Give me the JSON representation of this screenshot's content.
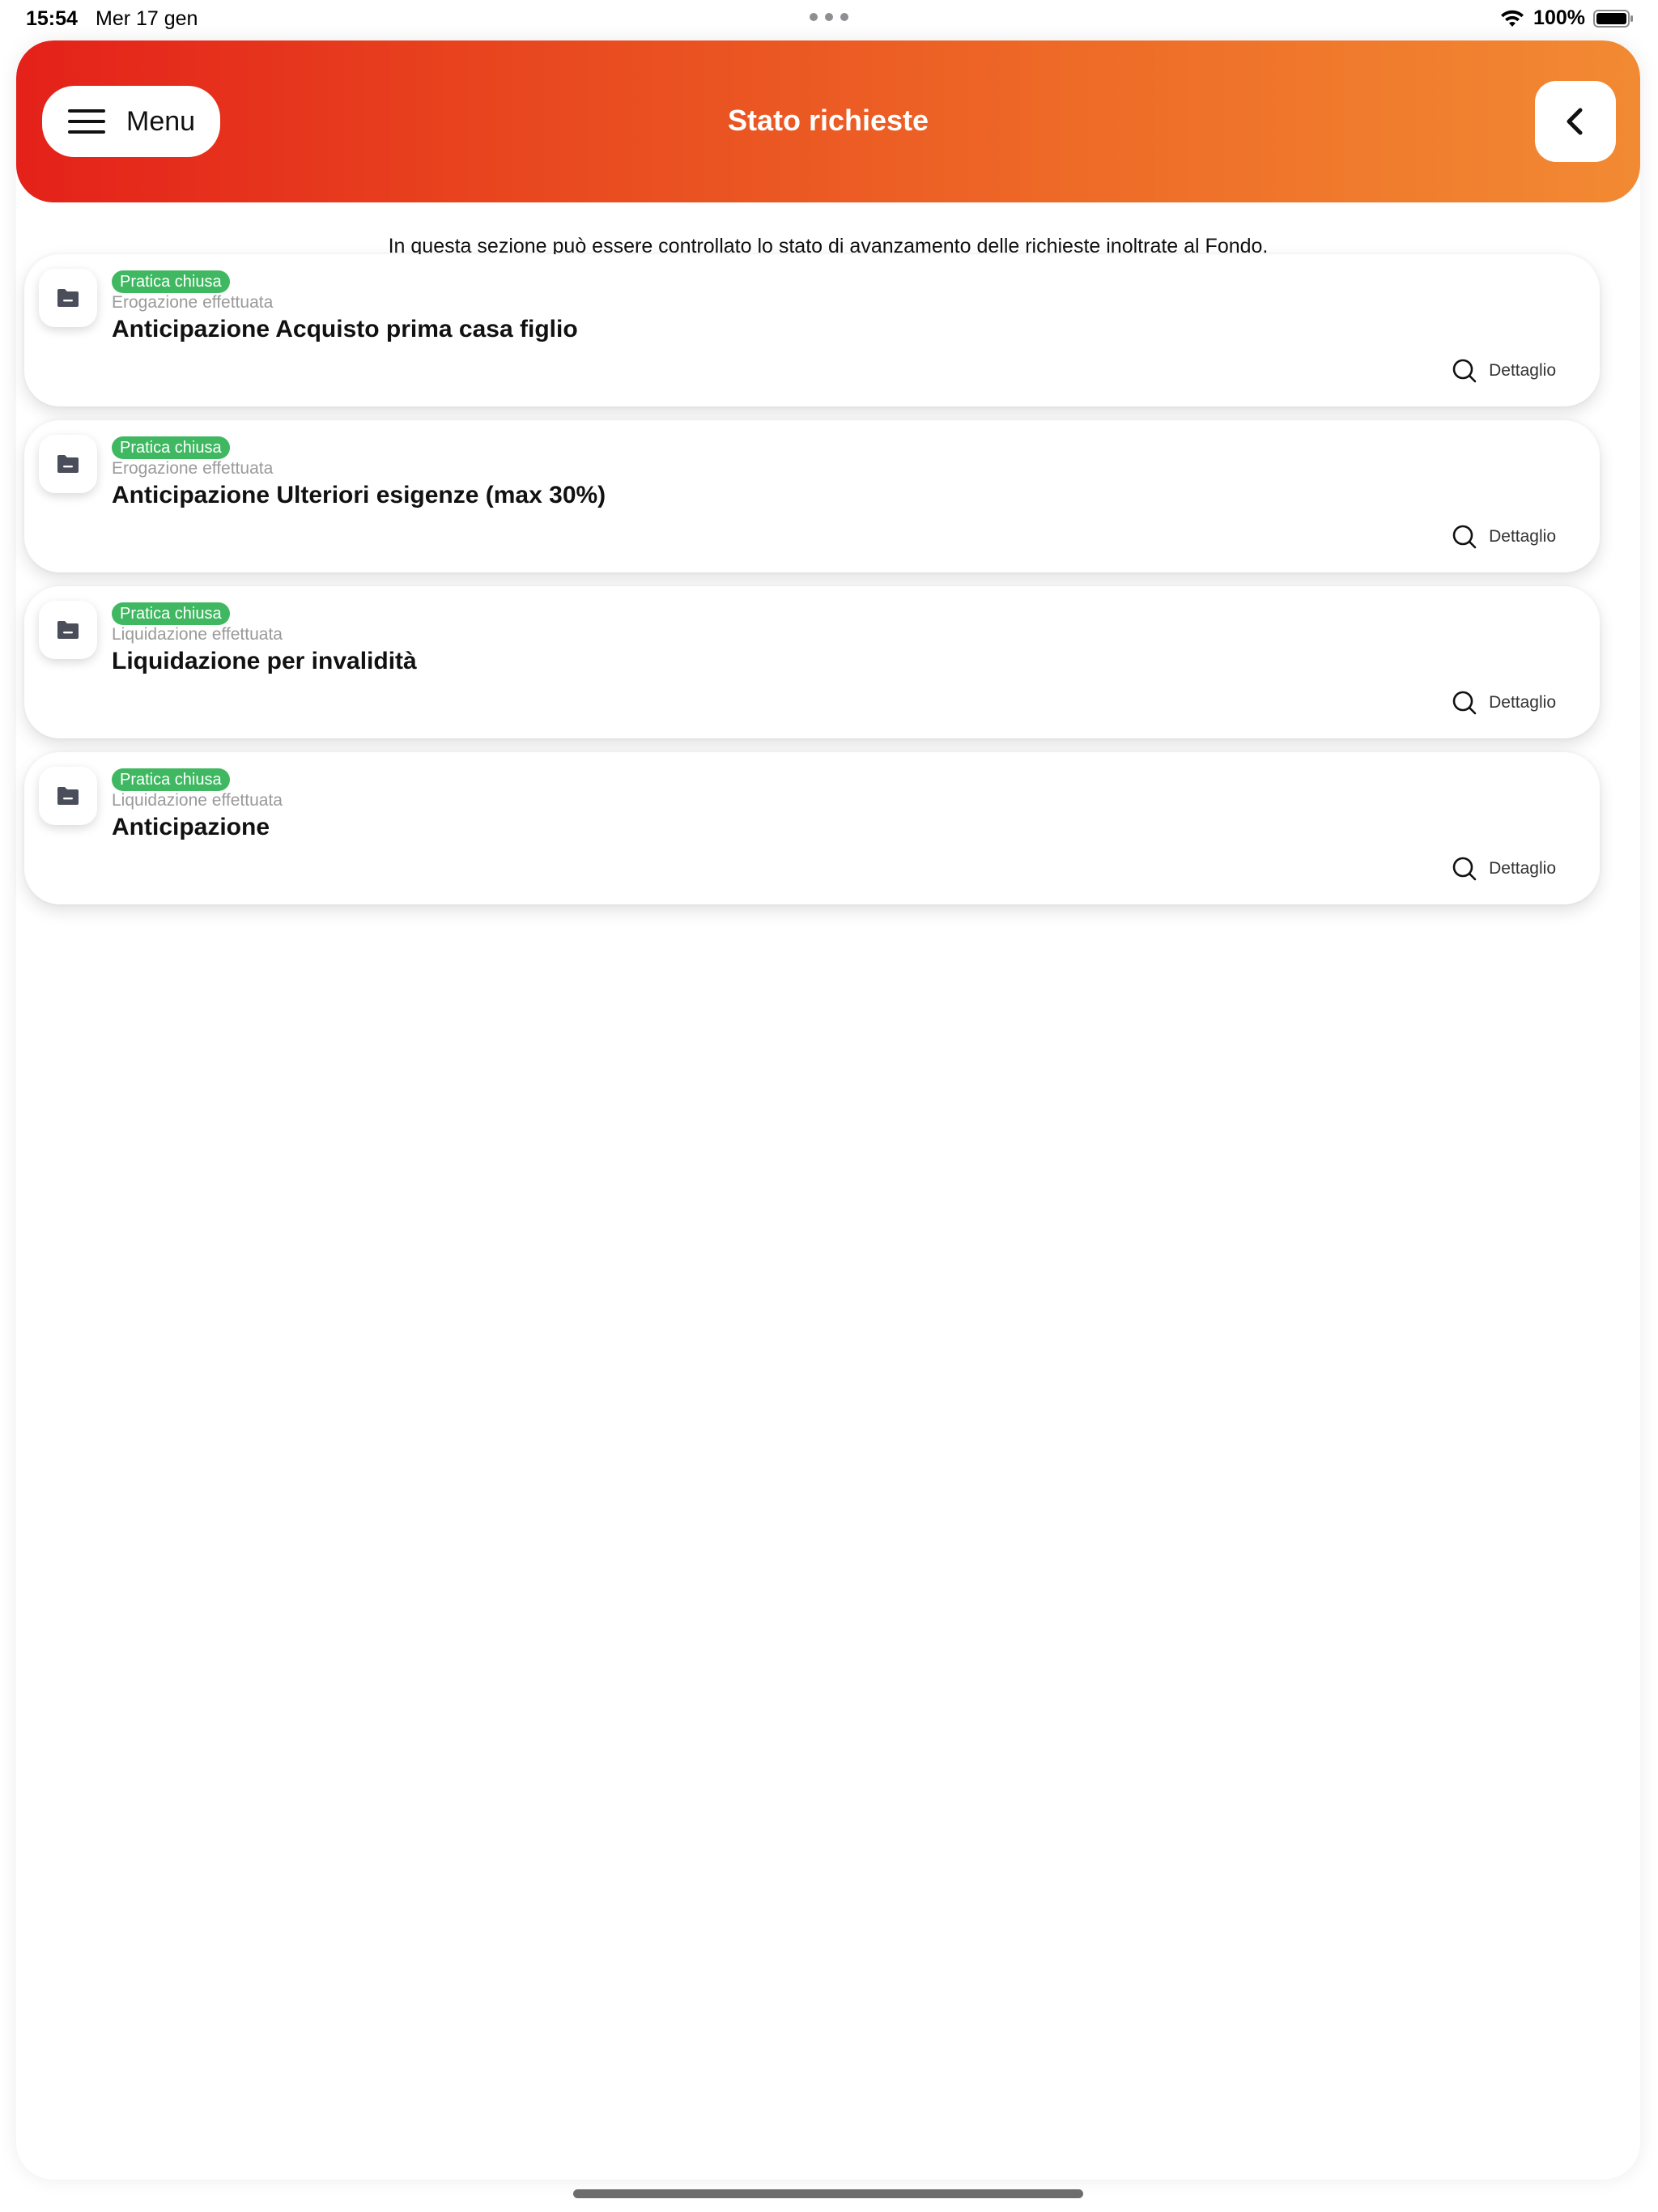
{
  "status_bar": {
    "time": "15:54",
    "date": "Mer 17 gen",
    "battery": "100%"
  },
  "header": {
    "menu_label": "Menu",
    "title": "Stato richieste",
    "gradient_colors": [
      "#e4211a",
      "#f28a33"
    ]
  },
  "intro_text": "In questa sezione può essere controllato lo stato di avanzamento delle richieste inoltrate al Fondo.",
  "requests": [
    {
      "badge": "Pratica chiusa",
      "subtitle": "Erogazione effettuata",
      "title": "Anticipazione Acquisto prima casa figlio",
      "detail_label": "Dettaglio"
    },
    {
      "badge": "Pratica chiusa",
      "subtitle": "Erogazione effettuata",
      "title": "Anticipazione Ulteriori esigenze (max 30%)",
      "detail_label": "Dettaglio"
    },
    {
      "badge": "Pratica chiusa",
      "subtitle": "Liquidazione effettuata",
      "title": "Liquidazione per invalidità",
      "detail_label": "Dettaglio"
    },
    {
      "badge": "Pratica chiusa",
      "subtitle": "Liquidazione effettuata",
      "title": "Anticipazione",
      "detail_label": "Dettaglio"
    }
  ],
  "colors": {
    "badge_green": "#3fb861",
    "subtitle_gray": "#9a9a9a"
  },
  "icons": {
    "menu": "hamburger-icon",
    "back": "chevron-left-icon",
    "card": "folder-icon",
    "detail": "search-icon"
  }
}
